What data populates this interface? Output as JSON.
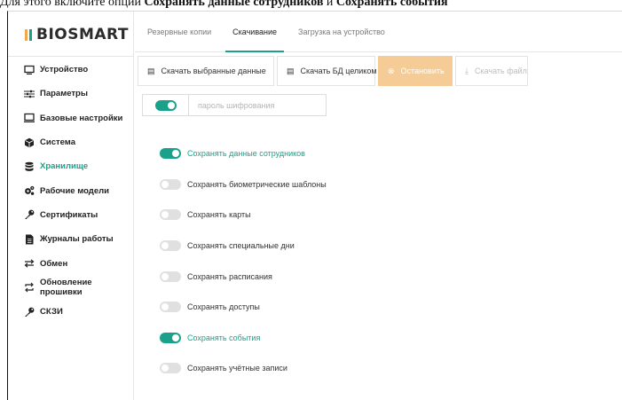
{
  "caption": {
    "prefix": "Для этого включите опции ",
    "bold1": "Сохранять данные сотрудников",
    "middle": " и ",
    "bold2": "Сохранять события"
  },
  "brand": {
    "name": "BIOSMART",
    "colors": {
      "accent": "#1aa18a",
      "warning": "#f5cc95",
      "logo_bar": "#f0a94a"
    }
  },
  "sidebar": {
    "items": [
      {
        "label": "Устройство",
        "icon": "monitor-icon",
        "active": false
      },
      {
        "label": "Параметры",
        "icon": "sliders-icon",
        "active": false
      },
      {
        "label": "Базовые настройки",
        "icon": "monitor-icon",
        "active": false
      },
      {
        "label": "Система",
        "icon": "cube-icon",
        "active": false
      },
      {
        "label": "Хранилище",
        "icon": "database-icon",
        "active": true
      },
      {
        "label": "Рабочие модели",
        "icon": "gears-icon",
        "active": false
      },
      {
        "label": "Сертификаты",
        "icon": "key-icon",
        "active": false
      },
      {
        "label": "Журналы работы",
        "icon": "document-icon",
        "active": false
      },
      {
        "label": "Обмен",
        "icon": "exchange-icon",
        "active": false
      },
      {
        "label": "Обновление прошивки",
        "icon": "refresh-icon",
        "active": false
      },
      {
        "label": "СКЗИ",
        "icon": "key-icon",
        "active": false
      }
    ]
  },
  "tabs": [
    {
      "label": "Резервные копии",
      "active": false
    },
    {
      "label": "Скачивание",
      "active": true
    },
    {
      "label": "Загрузка на устройство",
      "active": false
    }
  ],
  "toolbar": {
    "download_selected": "Скачать выбранные данные",
    "download_db": "Скачать БД целиком",
    "stop": "Остановить",
    "download_file": "Скачать файл"
  },
  "encryption": {
    "enabled": true,
    "placeholder": "пароль шифрования",
    "value": ""
  },
  "options": [
    {
      "label": "Сохранять данные сотрудников",
      "on": true
    },
    {
      "label": "Сохранять биометрические шаблоны",
      "on": false
    },
    {
      "label": "Сохранять карты",
      "on": false
    },
    {
      "label": "Сохранять специальные дни",
      "on": false
    },
    {
      "label": "Сохранять расписания",
      "on": false
    },
    {
      "label": "Сохранять доступы",
      "on": false
    },
    {
      "label": "Сохранять события",
      "on": true
    },
    {
      "label": "Сохранять учётные записи",
      "on": false
    }
  ]
}
